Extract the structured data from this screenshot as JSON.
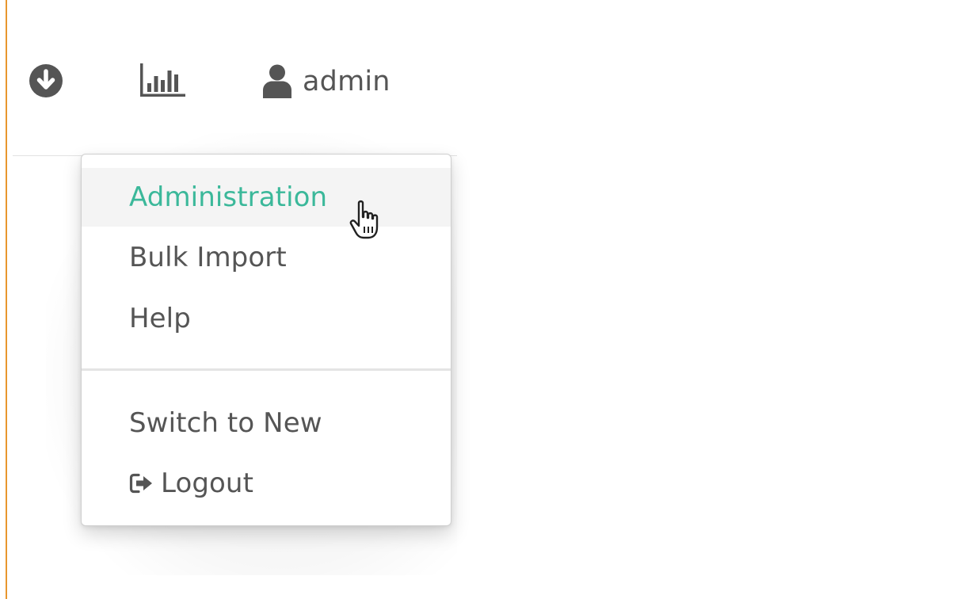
{
  "header": {
    "user_name": "admin",
    "icons": {
      "download": "download-circle-icon",
      "stats": "bar-chart-icon",
      "user": "user-icon"
    }
  },
  "menu": {
    "items": [
      {
        "label": "Administration",
        "active": true
      },
      {
        "label": "Bulk Import",
        "active": false
      },
      {
        "label": "Help",
        "active": false
      },
      {
        "label": "Switch to New",
        "active": false
      },
      {
        "label": "Logout",
        "active": false,
        "icon": "sign-out-icon"
      }
    ]
  },
  "colors": {
    "accent_active": "#3bb89a",
    "text": "#555555",
    "left_border": "#e8962e"
  }
}
